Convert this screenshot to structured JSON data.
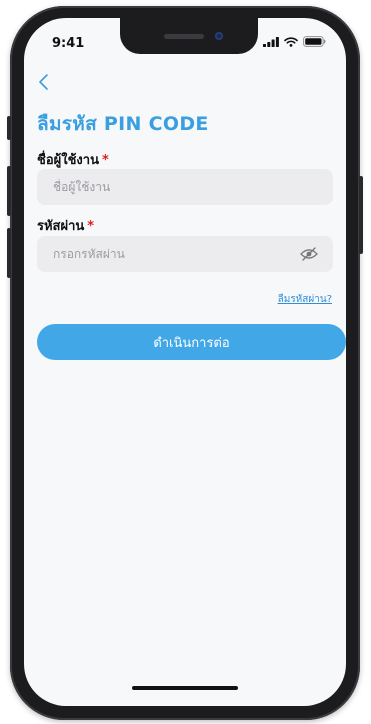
{
  "status_bar": {
    "time": "9:41"
  },
  "header": {
    "title": "ลืมรหัส PIN CODE"
  },
  "form": {
    "username": {
      "label": "ชื่อผู้ใช้งาน",
      "required_mark": "*",
      "placeholder": "ชื่อผู้ใช้งาน"
    },
    "password": {
      "label": "รหัสผ่าน",
      "required_mark": "*",
      "placeholder": "กรอกรหัสผ่าน"
    },
    "forgot_link": "ลืมรหัสผ่าน?",
    "continue_button": "ดำเนินการต่อ"
  },
  "colors": {
    "accent": "#41a7e6",
    "title": "#3a9fe0",
    "required": "#e02020",
    "input_bg": "#ececef"
  },
  "icons": {
    "back": "chevron-left-icon",
    "password_toggle": "eye-off-icon",
    "signal": "signal-icon",
    "wifi": "wifi-icon",
    "battery": "battery-icon"
  }
}
